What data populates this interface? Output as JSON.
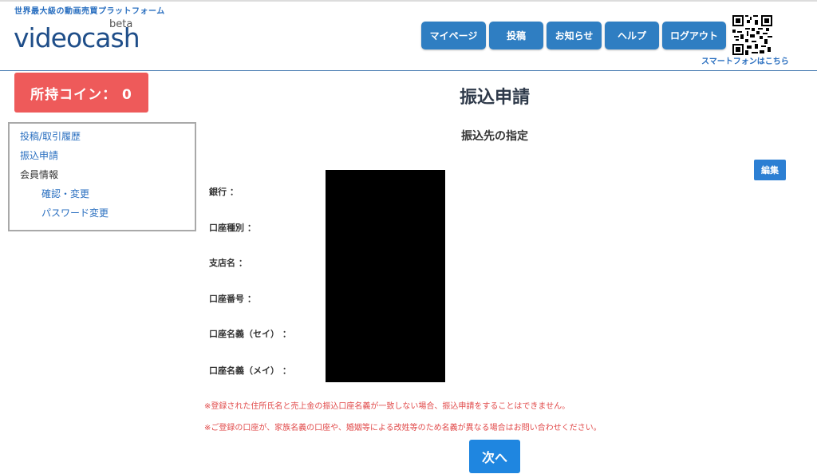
{
  "header": {
    "tagline": "世界最大級の動画売買プラットフォーム",
    "logo": {
      "wordmark": "videocash",
      "beta": "beta"
    },
    "nav": [
      {
        "label": "マイページ"
      },
      {
        "label": "投稿"
      },
      {
        "label": "お知らせ"
      },
      {
        "label": "ヘルプ"
      },
      {
        "label": "ログアウト"
      }
    ],
    "qr_icon": "qr-code-icon",
    "smartphone_link": "スマートフォンはこちら"
  },
  "sidebar": {
    "coins": "所持コイン： 0",
    "menu": [
      {
        "label": "投稿/取引履歴"
      },
      {
        "label": "振込申請"
      },
      {
        "label": "会員情報"
      },
      {
        "label": "確認・変更"
      },
      {
        "label": "パスワード変更"
      }
    ]
  },
  "main": {
    "title": "振込申請",
    "section_title": "振込先の指定",
    "edit_label": "編集",
    "fields": [
      {
        "label": "銀行 ："
      },
      {
        "label": "口座種別 ："
      },
      {
        "label": "支店名 ："
      },
      {
        "label": "口座番号 ："
      },
      {
        "label": "口座名義（セイ） ："
      },
      {
        "label": "口座名義（メイ） ："
      }
    ],
    "notices": [
      "※登録された住所氏名と売上金の振込口座名義が一致しない場合、振込申請をすることはできません。",
      "※ご登録の口座が、家族名義の口座や、婚姻等による改姓等のため名義が異なる場合はお問い合わせください。"
    ],
    "next_label": "次へ"
  },
  "colors": {
    "nav_button": "#2f7ec2",
    "coin_box": "#ee5a5a",
    "link": "#2a6fc0",
    "notice": "#e14a4a",
    "primary_button": "#1f86e0"
  }
}
